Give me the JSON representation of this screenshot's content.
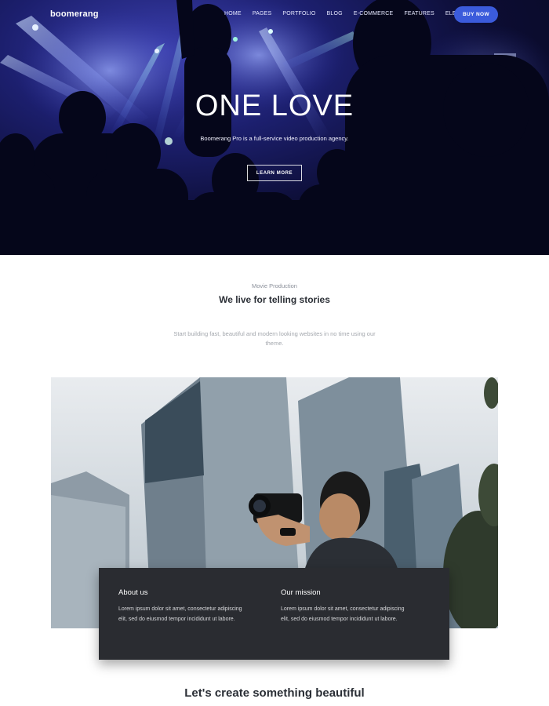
{
  "brand": {
    "logo": "boomerang"
  },
  "nav": {
    "items": [
      "HOME",
      "PAGES",
      "PORTFOLIO",
      "BLOG",
      "E-COMMERCE",
      "FEATURES",
      "ELEMENTS"
    ],
    "cta": "BUY NOW"
  },
  "hero": {
    "title": "ONE LOVE",
    "subtitle": "Boomerang Pro is a full-service video production agency.",
    "button": "LEARN MORE"
  },
  "intro": {
    "kicker": "Movie Production",
    "title": "We live for telling stories",
    "text": "Start building fast, beautiful and modern looking websites in no time using our theme."
  },
  "info": {
    "about": {
      "title": "About us",
      "text": "Lorem ipsum dolor sit amet, consectetur adipiscing elit, sed do eiusmod tempor incididunt ut labore."
    },
    "mission": {
      "title": "Our mission",
      "text": "Lorem ipsum dolor sit amet, consectetur adipiscing elit, sed do eiusmod tempor incididunt ut labore."
    }
  },
  "outro": {
    "title": "Let's create something beautiful"
  },
  "colors": {
    "accent": "#3b5bdb",
    "dark_box": "#2a2c31",
    "hero_deep": "#0c0d33"
  }
}
